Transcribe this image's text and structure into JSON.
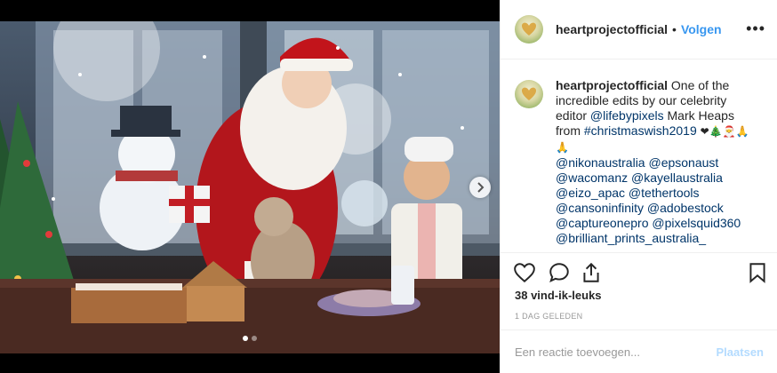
{
  "post": {
    "username": "heartprojectofficial",
    "follow_label": "Volgen",
    "separator": "•",
    "more_label": "•••",
    "media": {
      "active_slide": 1,
      "slide_count": 2
    },
    "caption": {
      "username": "heartprojectofficial",
      "text_line": "One of the incredible edits by our celebrity editor",
      "mention_1": "@lifebypixels",
      "text_after_mention": " Mark Heaps from",
      "hashtag": "#christmaswish2019",
      "emojis": "❤🎄🎅🙏 🙏",
      "mentions": [
        "@nikonaustralia @epsonaust",
        "@wacomanz @kayellaustralia",
        "@eizo_apac @tethertools",
        "@cansoninfinity @adobestock",
        "@captureonepro @pixelsquid360",
        "@brilliant_prints_australia_"
      ]
    },
    "likes_text": "38 vind-ik-leuks",
    "timestamp": "1 DAG GELEDEN",
    "comment": {
      "placeholder": "Een reactie toevoegen...",
      "post_label": "Plaatsen"
    }
  },
  "icons": [
    "heart-icon",
    "comment-icon",
    "share-icon",
    "bookmark-icon",
    "chevron-right-icon",
    "more-icon"
  ],
  "colors": {
    "link": "#003569",
    "follow": "#3897f0",
    "post_button_disabled": "#b3dbff",
    "border": "#efefef",
    "muted": "#999999"
  }
}
